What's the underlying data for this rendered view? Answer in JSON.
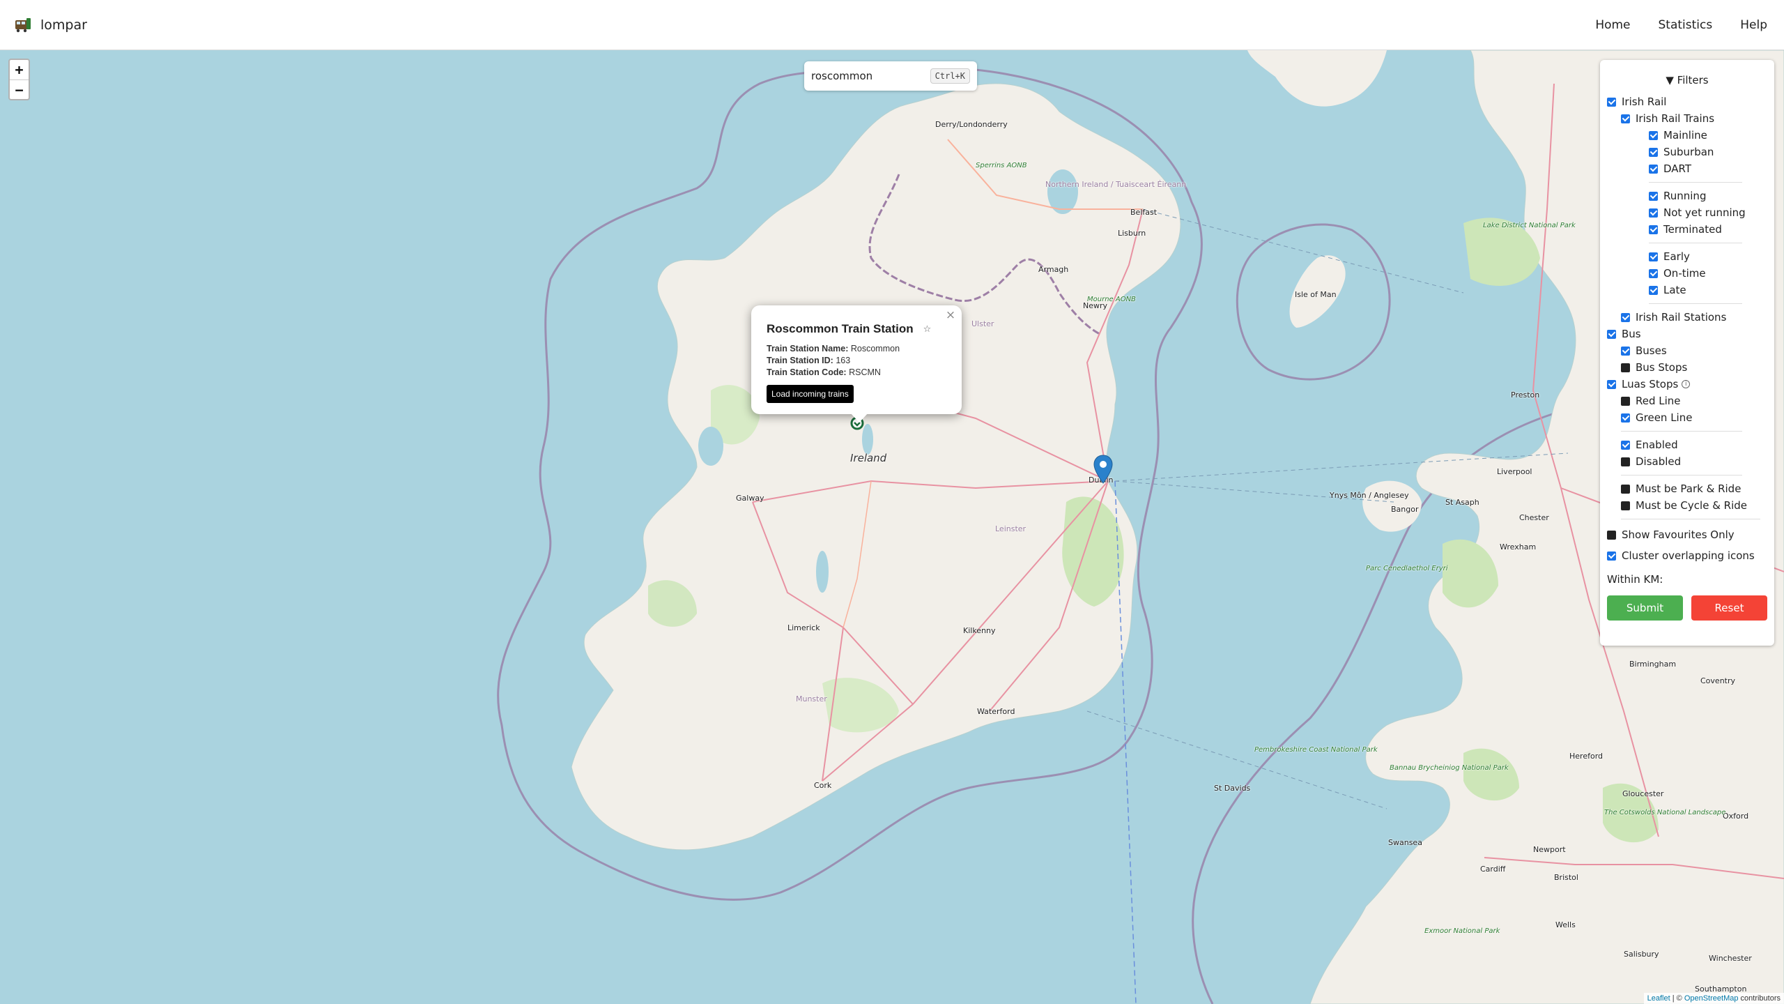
{
  "navbar": {
    "brand": "lompar",
    "links": [
      "Home",
      "Statistics",
      "Help"
    ]
  },
  "zoom": {
    "in": "+",
    "out": "−"
  },
  "search": {
    "value": "roscommon",
    "shortcut": "Ctrl+K"
  },
  "popup": {
    "title": "Roscommon Train Station",
    "close": "×",
    "star": "☆",
    "name_label": "Train Station Name:",
    "name_value": "Roscommon",
    "id_label": "Train Station ID:",
    "id_value": "163",
    "code_label": "Train Station Code:",
    "code_value": "RSCMN",
    "button": "Load incoming trains"
  },
  "filters": {
    "title": "▼ Filters",
    "irish_rail": "Irish Rail",
    "irish_rail_trains": "Irish Rail Trains",
    "mainline": "Mainline",
    "suburban": "Suburban",
    "dart": "DART",
    "running": "Running",
    "not_yet_running": "Not yet running",
    "terminated": "Terminated",
    "early": "Early",
    "on_time": "On-time",
    "late": "Late",
    "irish_rail_stations": "Irish Rail Stations",
    "bus": "Bus",
    "buses": "Buses",
    "bus_stops": "Bus Stops",
    "luas_stops": "Luas Stops",
    "info": "i",
    "red_line": "Red Line",
    "green_line": "Green Line",
    "enabled": "Enabled",
    "disabled": "Disabled",
    "park_ride": "Must be Park & Ride",
    "cycle_ride": "Must be Cycle & Ride",
    "favourites": "Show Favourites Only",
    "cluster": "Cluster overlapping icons",
    "within": "Within KM:",
    "submit": "Submit",
    "reset": "Reset"
  },
  "map_labels": {
    "ireland": "Ireland",
    "dublin": "Dublin",
    "galway": "Galway",
    "limerick": "Limerick",
    "cork": "Cork",
    "waterford": "Waterford",
    "kilkenny": "Kilkenny",
    "belfast": "Belfast",
    "derry": "Derry/Londonderry",
    "armagh": "Armagh",
    "newry": "Newry",
    "lisburn": "Lisburn",
    "ulster": "Ulster",
    "munster": "Munster",
    "leinster": "Leinster",
    "isle_of_man": "Isle of Man",
    "isle_of_man_gd": "Isle of Man",
    "liverpool": "Liverpool",
    "preston": "Preston",
    "chester": "Chester",
    "st_asaph": "St Asaph",
    "bangor": "Bangor",
    "anglesey": "Ynys Môn / Anglesey",
    "wrexham": "Wrexham",
    "birmingham": "Birmingham",
    "coventry": "Coventry",
    "hereford": "Hereford",
    "gloucester": "Gloucester",
    "oxford": "Oxford",
    "newport": "Newport",
    "cardiff": "Cardiff",
    "bristol": "Bristol",
    "swansea": "Swansea",
    "st_davids": "St Davids",
    "wells": "Wells",
    "salisbury": "Salisbury",
    "winchester": "Winchester",
    "southampton": "Southampton",
    "eryri": "Parc Cenedlaethol Eryri",
    "lake_district": "Lake District National Park",
    "cotswolds": "The Cotswolds National Landscape",
    "exmoor": "Exmoor National Park",
    "sperrins": "Sperrins AONB",
    "mourne": "Mourne AONB",
    "pembrokeshire": "Pembrokeshire Coast National Park",
    "brecon": "Bannau Brycheiniog National Park",
    "ni_tuaisceart": "Northern Ireland / Tuaisceart Éireann"
  },
  "attribution": {
    "leaflet": "Leaflet",
    "sep": " | © ",
    "osm": "OpenStreetMap",
    "contributors": " contributors"
  },
  "colors": {
    "sea": "#aad3df",
    "land": "#f2efe9",
    "checkbox": "#1a73e8",
    "submit": "#4caf50",
    "reset": "#f44336",
    "marker_blue": "#2a81cb",
    "marker_green": "#1b6e3c"
  }
}
